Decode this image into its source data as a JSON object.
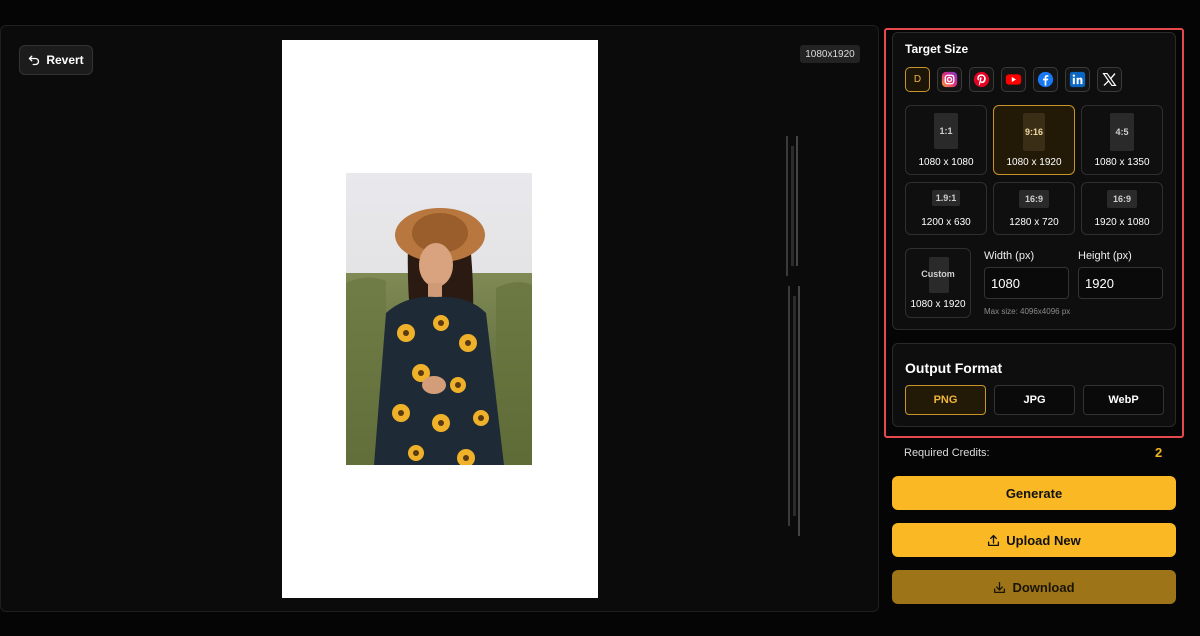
{
  "canvas": {
    "revert_label": "Revert",
    "size_tag": "1080x1920"
  },
  "target_size": {
    "title": "Target Size",
    "platforms": [
      {
        "name": "default",
        "label": "D",
        "active": true
      },
      {
        "name": "instagram"
      },
      {
        "name": "pinterest"
      },
      {
        "name": "youtube"
      },
      {
        "name": "facebook"
      },
      {
        "name": "linkedin"
      },
      {
        "name": "x"
      }
    ],
    "ratios": [
      {
        "ratio": "1:1",
        "dims": "1080 x 1080",
        "active": false
      },
      {
        "ratio": "9:16",
        "dims": "1080 x 1920",
        "active": true
      },
      {
        "ratio": "4:5",
        "dims": "1080 x 1350",
        "active": false
      },
      {
        "ratio": "1.9:1",
        "dims": "1200 x 630",
        "active": false
      },
      {
        "ratio": "16:9",
        "dims": "1280 x 720",
        "active": false
      },
      {
        "ratio": "16:9",
        "dims": "1920 x 1080",
        "active": false
      }
    ],
    "custom": {
      "label": "Custom",
      "dims": "1080 x 1920",
      "width_label": "Width (px)",
      "width_value": "1080",
      "height_label": "Height (px)",
      "height_value": "1920",
      "max_size": "Max size: 4096x4096 px"
    }
  },
  "output_format": {
    "title": "Output Format",
    "options": [
      "PNG",
      "JPG",
      "WebP"
    ],
    "selected": "PNG"
  },
  "credits": {
    "label": "Required Credits:",
    "value": "2"
  },
  "actions": {
    "generate": "Generate",
    "upload": "Upload New",
    "download": "Download"
  },
  "colors": {
    "accent": "#f9b824",
    "highlight": "#e5484d",
    "active_border": "#c8952a"
  }
}
